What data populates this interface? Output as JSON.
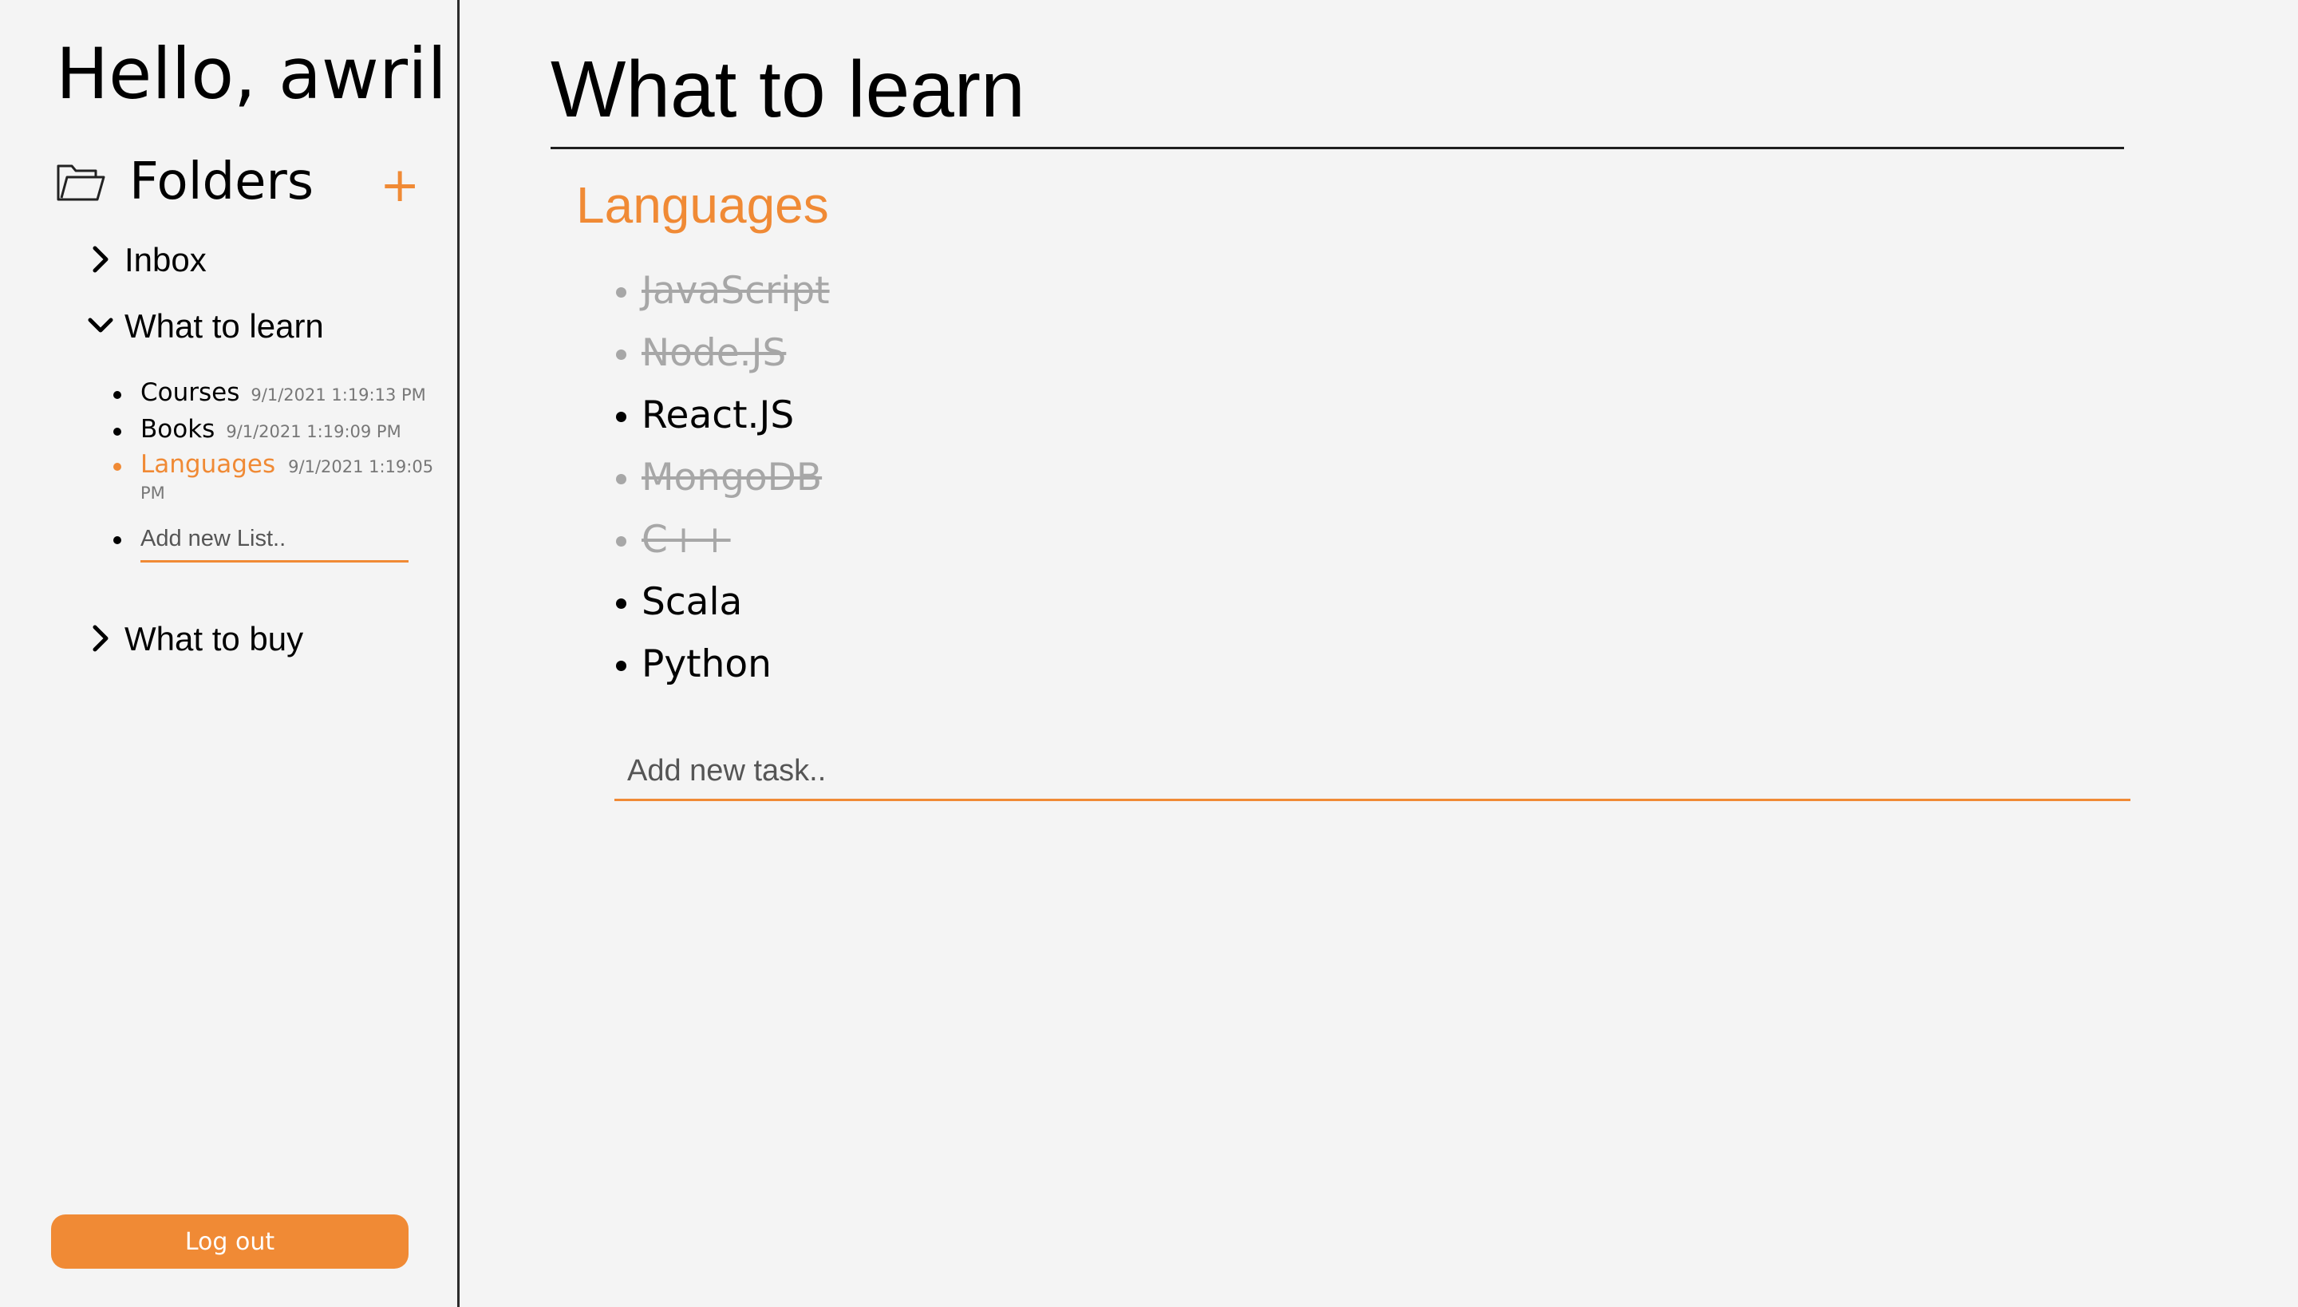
{
  "sidebar": {
    "greeting": "Hello, awril",
    "folders_title": "Folders",
    "add_folder_symbol": "+",
    "folders": [
      {
        "name": "Inbox",
        "expanded": false
      },
      {
        "name": "What to learn",
        "expanded": true
      },
      {
        "name": "What to buy",
        "expanded": false
      }
    ],
    "lists": [
      {
        "name": "Courses",
        "date": "9/1/2021 1:19:13 PM",
        "active": false
      },
      {
        "name": "Books",
        "date": "9/1/2021 1:19:09 PM",
        "active": false
      },
      {
        "name": "Languages",
        "date": "9/1/2021 1:19:05 PM",
        "active": true
      }
    ],
    "add_list_placeholder": "Add new List..",
    "logout_label": "Log out"
  },
  "main": {
    "folder_title": "What to learn",
    "list_title": "Languages",
    "tasks": [
      {
        "name": "JavaScript",
        "done": true
      },
      {
        "name": "Node.JS",
        "done": true
      },
      {
        "name": "React.JS",
        "done": false
      },
      {
        "name": "MongoDB",
        "done": true
      },
      {
        "name": "C++",
        "done": true
      },
      {
        "name": "Scala",
        "done": false
      },
      {
        "name": "Python",
        "done": false
      }
    ],
    "add_task_placeholder": "Add new task.."
  },
  "colors": {
    "accent": "#f08a35",
    "background": "#f4f4f4",
    "done_text": "#a7a7a7"
  },
  "icons": {
    "folder": "folder-open-icon",
    "collapsed": "chevron-right-icon",
    "expanded": "chevron-down-icon"
  }
}
